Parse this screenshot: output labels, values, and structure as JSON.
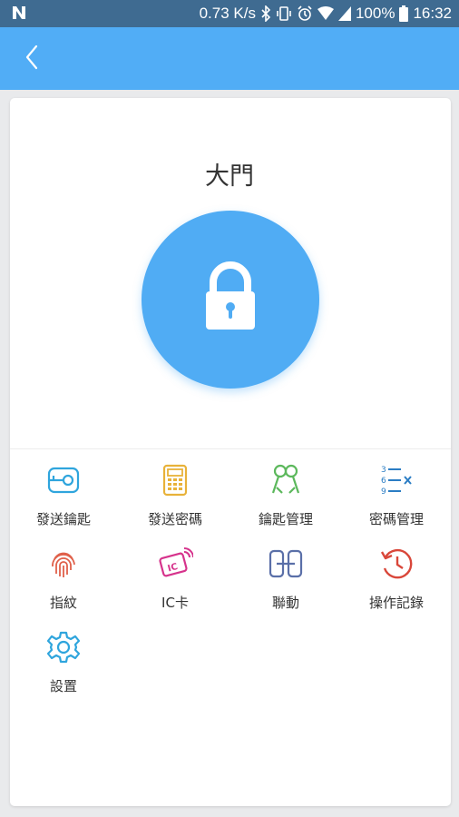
{
  "status_bar": {
    "speed": "0.73 K/s",
    "battery": "100%",
    "time": "16:32"
  },
  "app_bar": {
    "back_label": "<"
  },
  "door": {
    "name": "大門"
  },
  "menu": {
    "items": [
      {
        "label": "發送鑰匙",
        "icon": "key-card-icon"
      },
      {
        "label": "發送密碼",
        "icon": "keypad-icon"
      },
      {
        "label": "鑰匙管理",
        "icon": "keys-icon"
      },
      {
        "label": "密碼管理",
        "icon": "password-list-icon"
      },
      {
        "label": "指紋",
        "icon": "fingerprint-icon"
      },
      {
        "label": "IC卡",
        "icon": "ic-card-icon"
      },
      {
        "label": "聯動",
        "icon": "link-icon"
      },
      {
        "label": "操作記錄",
        "icon": "history-icon"
      },
      {
        "label": "設置",
        "icon": "gear-icon"
      }
    ]
  },
  "colors": {
    "status_bar": "#3f6b91",
    "app_bar": "#51adf6",
    "lock_circle": "#50acf4"
  }
}
